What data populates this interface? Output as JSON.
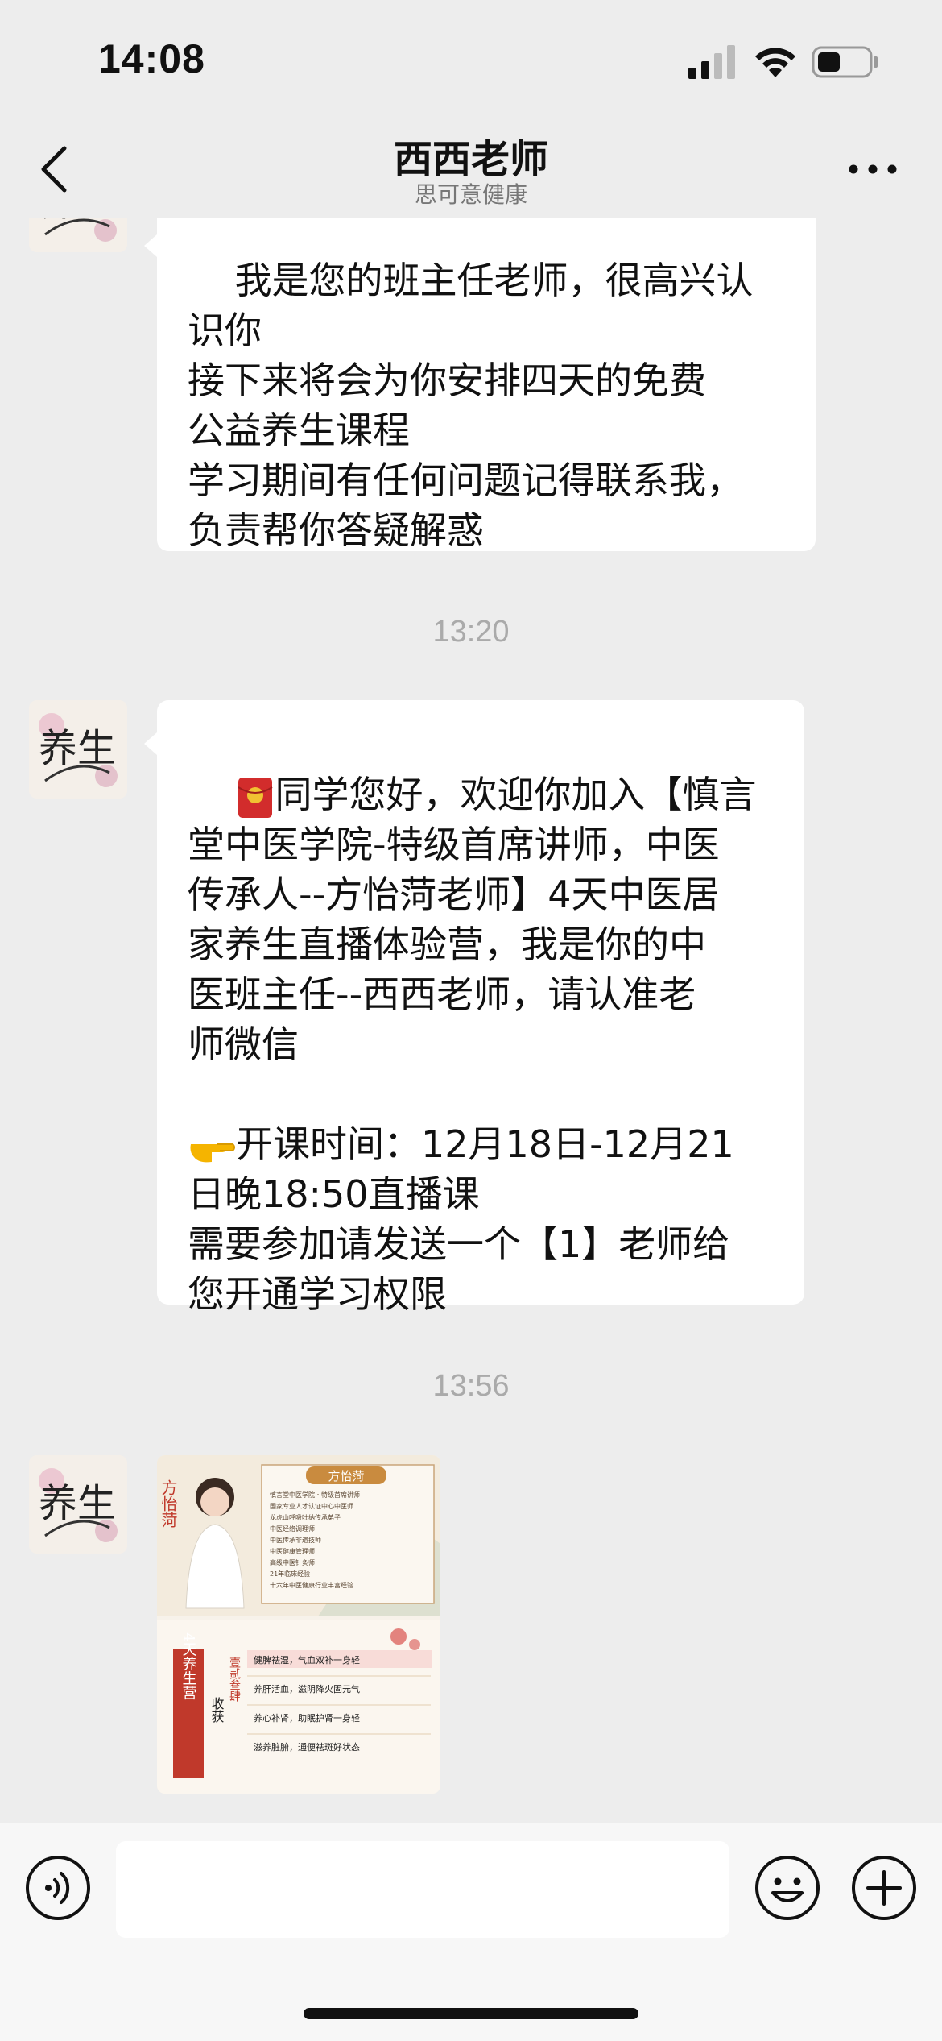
{
  "status_bar": {
    "time": "14:08",
    "battery_level": 0.45
  },
  "nav": {
    "title": "西西老师",
    "subtitle": "思可意健康",
    "back_icon": "chevron-left-icon",
    "more_icon": "ellipsis-icon"
  },
  "messages": [
    {
      "type": "text",
      "text": "我是您的班主任老师，很高兴认\n识你\n接下来将会为你安排四天的免费\n公益养生课程\n学习期间有任何问题记得联系我，\n负责帮你答疑解惑"
    },
    {
      "type": "time",
      "text": "13:20"
    },
    {
      "type": "text",
      "emoji": "red-envelope-icon",
      "text": "同学您好，欢迎你加入【慎言\n堂中医学院-特级首席讲师，中医\n传承人--方怡菏老师】4天中医居\n家养生直播体验营，我是你的中\n医班主任--西西老师，请认准老\n师微信\n\n",
      "emoji2": "pointing-hand-icon",
      "text2": "开课时间：12月18日-12月21\n日晚18:50直播课\n需要参加请发送一个【1】老师给\n您开通学习权限"
    },
    {
      "type": "time",
      "text": "13:56"
    },
    {
      "type": "image",
      "poster": {
        "name_tag": "方怡菏",
        "vertical_name": "方怡菏",
        "credentials": [
          "慎言堂中医学院・特级首席讲师",
          "国家专业人才认证中心中医师",
          "龙虎山呼吸吐纳传承弟子",
          "中医经络调理师",
          "中医传承非遗技师",
          "中医健康管理师",
          "高级中医针灸师",
          "21年临床经验",
          "十六年中医健康行业丰富经验"
        ],
        "camp_label": "4天养生营",
        "gain_label": "收获",
        "side_chars": "壹贰叁肆",
        "benefits": [
          "健脾祛湿，气血双补一身轻",
          "养肝活血，滋阴降火固元气",
          "养心补肾，助眠护肾一身轻",
          "滋养脏腑，通便祛斑好状态"
        ]
      }
    }
  ],
  "avatar": {
    "text": "养生"
  },
  "input_bar": {
    "voice_icon": "voice-icon",
    "emoji_icon": "emoji-icon",
    "plus_icon": "plus-icon",
    "value": ""
  }
}
